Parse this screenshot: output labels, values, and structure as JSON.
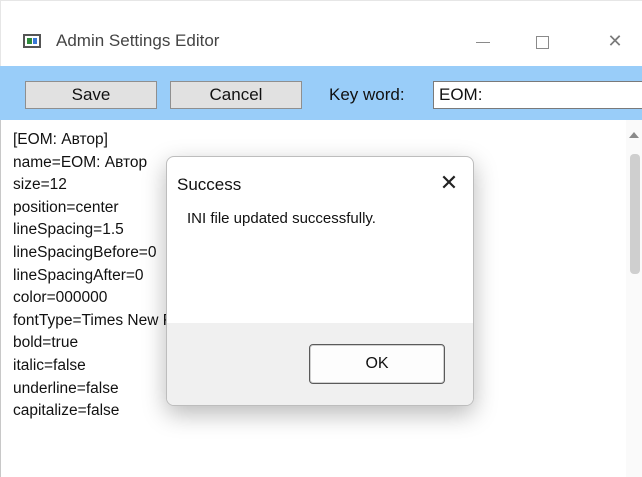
{
  "window": {
    "title": "Admin Settings Editor",
    "minimize_label": "—",
    "maximize_label": "□",
    "close_label": "✕"
  },
  "toolbar": {
    "save_label": "Save",
    "cancel_label": "Cancel",
    "keyword_label": "Key word:",
    "keyword_value": "EOM:",
    "background_color": "#99cdf9"
  },
  "editor": {
    "lines": [
      "[EOM: Автор]",
      "name=EOM: Автор",
      "size=12",
      "position=center",
      "lineSpacing=1.5",
      "lineSpacingBefore=0",
      "lineSpacingAfter=0",
      "color=000000",
      "fontType=Times New Roman",
      "bold=true",
      "italic=false",
      "underline=false",
      "capitalize=false"
    ]
  },
  "dialog": {
    "title": "Success",
    "close_label": "✕",
    "message": "INI file updated successfully.",
    "ok_label": "OK"
  }
}
